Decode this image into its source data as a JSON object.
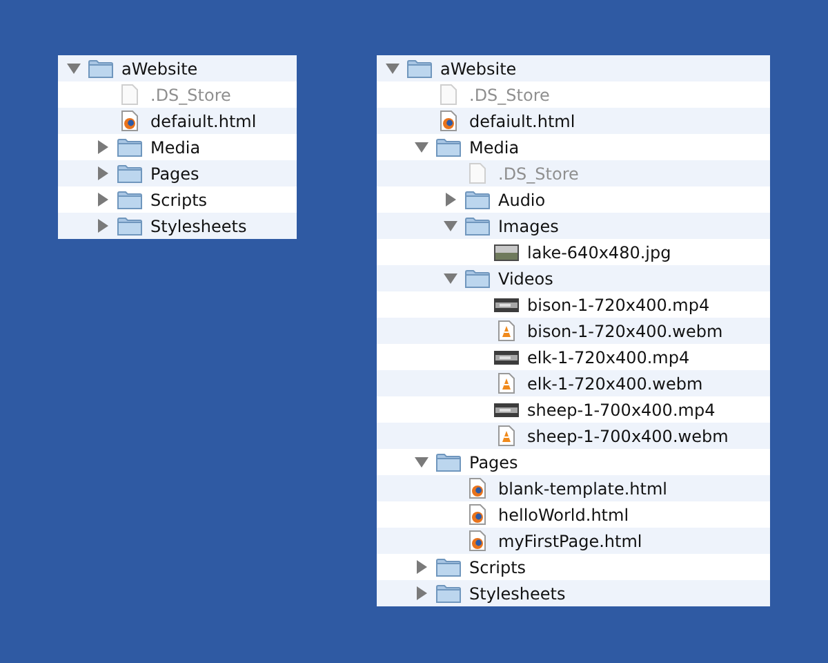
{
  "trees": [
    {
      "name": "aWebsite",
      "kind": "folder",
      "expanded": true,
      "children": [
        {
          "name": ".DS_Store",
          "kind": "hidden"
        },
        {
          "name": "defaiult.html",
          "kind": "html"
        },
        {
          "name": "Media",
          "kind": "folder",
          "expanded": false
        },
        {
          "name": "Pages",
          "kind": "folder",
          "expanded": false
        },
        {
          "name": "Scripts",
          "kind": "folder",
          "expanded": false
        },
        {
          "name": "Stylesheets",
          "kind": "folder",
          "expanded": false
        }
      ]
    },
    {
      "name": "aWebsite",
      "kind": "folder",
      "expanded": true,
      "children": [
        {
          "name": ".DS_Store",
          "kind": "hidden"
        },
        {
          "name": "defaiult.html",
          "kind": "html"
        },
        {
          "name": "Media",
          "kind": "folder",
          "expanded": true,
          "children": [
            {
              "name": ".DS_Store",
              "kind": "hidden"
            },
            {
              "name": "Audio",
              "kind": "folder",
              "expanded": false
            },
            {
              "name": "Images",
              "kind": "folder",
              "expanded": true,
              "children": [
                {
                  "name": "lake-640x480.jpg",
                  "kind": "image"
                }
              ]
            },
            {
              "name": "Videos",
              "kind": "folder",
              "expanded": true,
              "children": [
                {
                  "name": "bison-1-720x400.mp4",
                  "kind": "video"
                },
                {
                  "name": "bison-1-720x400.webm",
                  "kind": "webm"
                },
                {
                  "name": "elk-1-720x400.mp4",
                  "kind": "video"
                },
                {
                  "name": "elk-1-720x400.webm",
                  "kind": "webm"
                },
                {
                  "name": "sheep-1-700x400.mp4",
                  "kind": "video"
                },
                {
                  "name": "sheep-1-700x400.webm",
                  "kind": "webm"
                }
              ]
            }
          ]
        },
        {
          "name": "Pages",
          "kind": "folder",
          "expanded": true,
          "children": [
            {
              "name": "blank-template.html",
              "kind": "html"
            },
            {
              "name": "helloWorld.html",
              "kind": "html"
            },
            {
              "name": "myFirstPage.html",
              "kind": "html"
            }
          ]
        },
        {
          "name": "Scripts",
          "kind": "folder",
          "expanded": false
        },
        {
          "name": "Stylesheets",
          "kind": "folder",
          "expanded": false
        }
      ]
    }
  ]
}
